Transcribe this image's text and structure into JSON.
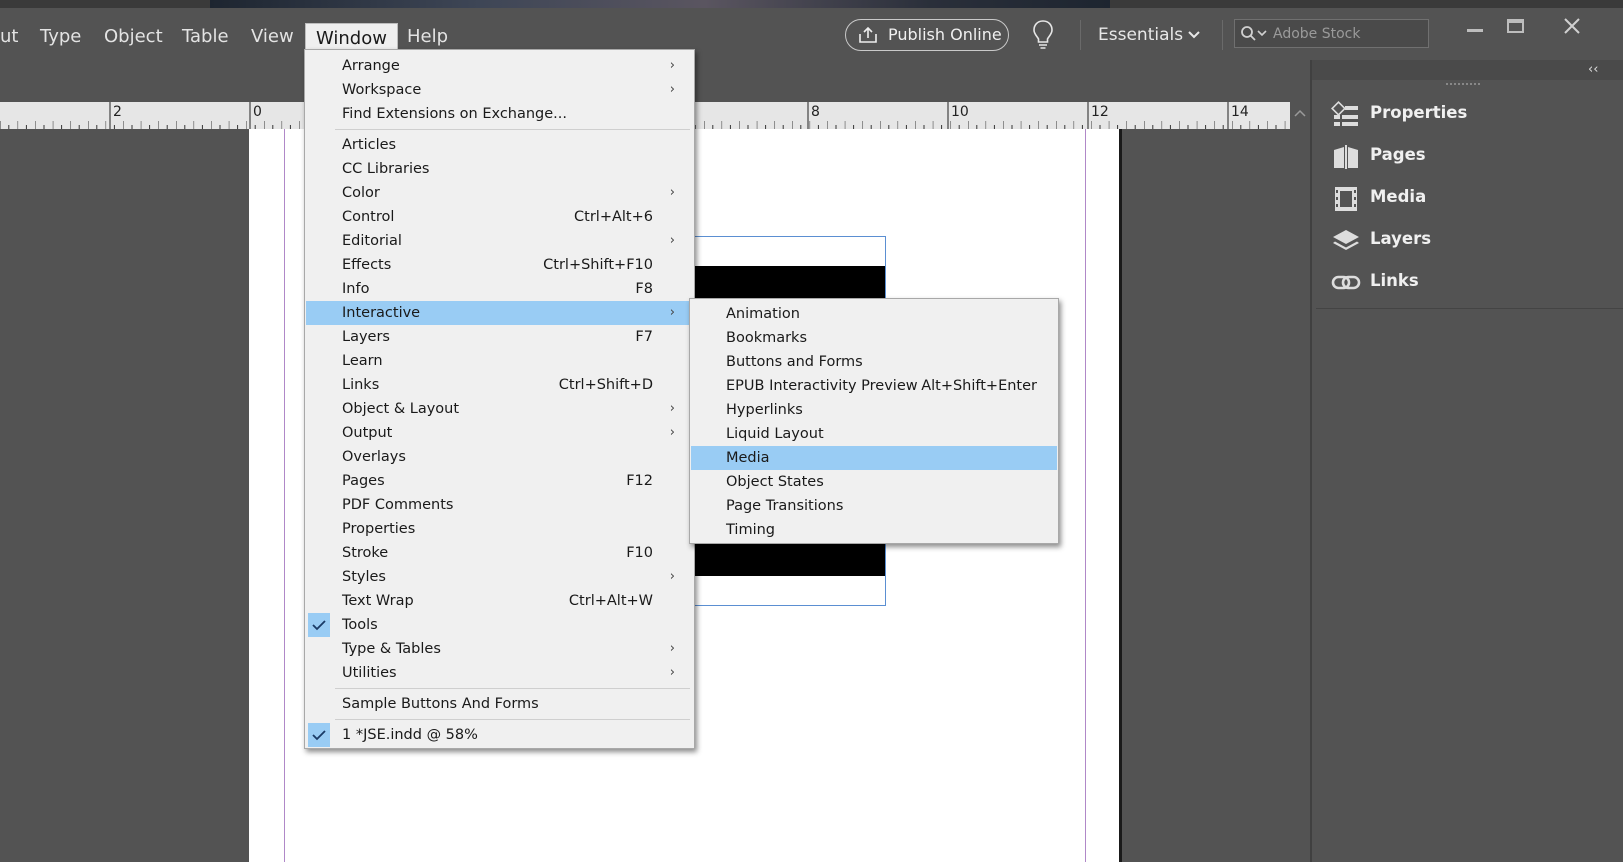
{
  "menubar": {
    "items": [
      "ut",
      "Type",
      "Object",
      "Table",
      "View",
      "Window",
      "Help"
    ],
    "active": "Window"
  },
  "toolbar": {
    "publish_label": "Publish Online",
    "workspace_label": "Essentials",
    "search_placeholder": "Adobe Stock"
  },
  "ruler": {
    "labels": [
      "2",
      "0",
      "8",
      "10",
      "12",
      "14"
    ]
  },
  "window_menu": {
    "items": [
      {
        "label": "Arrange",
        "shortcut": "",
        "submenu": true
      },
      {
        "label": "Workspace",
        "shortcut": "",
        "submenu": true
      },
      {
        "label": "Find Extensions on Exchange...",
        "shortcut": "",
        "submenu": false
      },
      {
        "label": "Articles",
        "shortcut": "",
        "submenu": false
      },
      {
        "label": "CC Libraries",
        "shortcut": "",
        "submenu": false
      },
      {
        "label": "Color",
        "shortcut": "",
        "submenu": true
      },
      {
        "label": "Control",
        "shortcut": "Ctrl+Alt+6",
        "submenu": false
      },
      {
        "label": "Editorial",
        "shortcut": "",
        "submenu": true
      },
      {
        "label": "Effects",
        "shortcut": "Ctrl+Shift+F10",
        "submenu": false
      },
      {
        "label": "Info",
        "shortcut": "F8",
        "submenu": false
      },
      {
        "label": "Interactive",
        "shortcut": "",
        "submenu": true,
        "highlighted": true
      },
      {
        "label": "Layers",
        "shortcut": "F7",
        "submenu": false
      },
      {
        "label": "Learn",
        "shortcut": "",
        "submenu": false
      },
      {
        "label": "Links",
        "shortcut": "Ctrl+Shift+D",
        "submenu": false
      },
      {
        "label": "Object & Layout",
        "shortcut": "",
        "submenu": true
      },
      {
        "label": "Output",
        "shortcut": "",
        "submenu": true
      },
      {
        "label": "Overlays",
        "shortcut": "",
        "submenu": false
      },
      {
        "label": "Pages",
        "shortcut": "F12",
        "submenu": false
      },
      {
        "label": "PDF Comments",
        "shortcut": "",
        "submenu": false
      },
      {
        "label": "Properties",
        "shortcut": "",
        "submenu": false
      },
      {
        "label": "Stroke",
        "shortcut": "F10",
        "submenu": false
      },
      {
        "label": "Styles",
        "shortcut": "",
        "submenu": true
      },
      {
        "label": "Text Wrap",
        "shortcut": "Ctrl+Alt+W",
        "submenu": false
      },
      {
        "label": "Tools",
        "shortcut": "",
        "submenu": false,
        "checked": true
      },
      {
        "label": "Type & Tables",
        "shortcut": "",
        "submenu": true
      },
      {
        "label": "Utilities",
        "shortcut": "",
        "submenu": true
      },
      {
        "label": "Sample Buttons And Forms",
        "shortcut": "",
        "submenu": false
      },
      {
        "label": "1 *JSE.indd @ 58%",
        "shortcut": "",
        "submenu": false,
        "checked": true
      }
    ]
  },
  "interactive_submenu": {
    "items": [
      {
        "label": "Animation",
        "shortcut": ""
      },
      {
        "label": "Bookmarks",
        "shortcut": ""
      },
      {
        "label": "Buttons and Forms",
        "shortcut": ""
      },
      {
        "label": "EPUB Interactivity Preview",
        "shortcut": "Alt+Shift+Enter"
      },
      {
        "label": "Hyperlinks",
        "shortcut": ""
      },
      {
        "label": "Liquid Layout",
        "shortcut": ""
      },
      {
        "label": "Media",
        "shortcut": "",
        "highlighted": true
      },
      {
        "label": "Object States",
        "shortcut": ""
      },
      {
        "label": "Page Transitions",
        "shortcut": ""
      },
      {
        "label": "Timing",
        "shortcut": ""
      }
    ]
  },
  "dock": {
    "collapse_glyph": "‹‹",
    "items": [
      {
        "label": "Properties",
        "icon": "properties-icon"
      },
      {
        "label": "Pages",
        "icon": "pages-icon"
      },
      {
        "label": "Media",
        "icon": "media-icon"
      },
      {
        "label": "Layers",
        "icon": "layers-icon"
      },
      {
        "label": "Links",
        "icon": "links-icon"
      }
    ]
  },
  "colors": {
    "chrome": "#535353",
    "menu_bg": "#f0f0f0",
    "highlight": "#99ccf4",
    "frame_stroke": "#5b8fd2",
    "margin_guide": "#b088c8"
  }
}
